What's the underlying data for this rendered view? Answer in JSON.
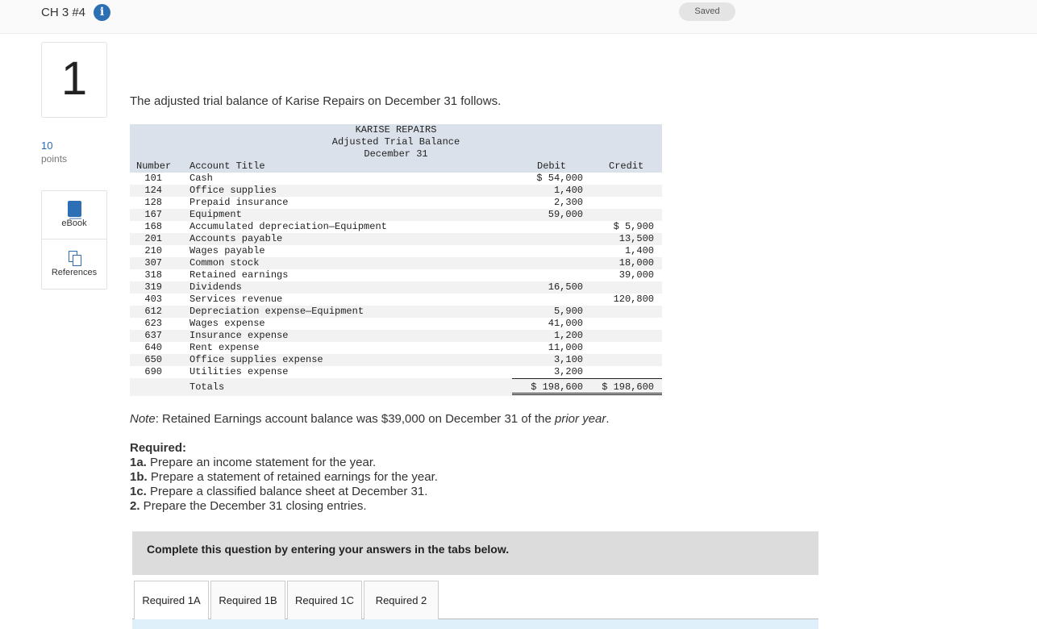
{
  "header": {
    "title": "CH 3 #4",
    "info_glyph": "i",
    "saved_label": "Saved"
  },
  "question": {
    "number": "1",
    "points_value": "10",
    "points_label": "points"
  },
  "tools": {
    "ebook_label": "eBook",
    "references_label": "References"
  },
  "intro_text": "The adjusted trial balance of Karise Repairs on December 31 follows.",
  "trial_balance": {
    "company": "KARISE REPAIRS",
    "statement": "Adjusted Trial Balance",
    "date": "December 31",
    "col_number": "Number",
    "col_title": "Account Title",
    "col_debit": "Debit",
    "col_credit": "Credit",
    "rows": [
      {
        "num": "101",
        "title": "Cash",
        "debit": "$ 54,000",
        "credit": ""
      },
      {
        "num": "124",
        "title": "Office supplies",
        "debit": "1,400",
        "credit": ""
      },
      {
        "num": "128",
        "title": "Prepaid insurance",
        "debit": "2,300",
        "credit": ""
      },
      {
        "num": "167",
        "title": "Equipment",
        "debit": "59,000",
        "credit": ""
      },
      {
        "num": "168",
        "title": "Accumulated depreciation—Equipment",
        "debit": "",
        "credit": "$ 5,900"
      },
      {
        "num": "201",
        "title": "Accounts payable",
        "debit": "",
        "credit": "13,500"
      },
      {
        "num": "210",
        "title": "Wages payable",
        "debit": "",
        "credit": "1,400"
      },
      {
        "num": "307",
        "title": "Common stock",
        "debit": "",
        "credit": "18,000"
      },
      {
        "num": "318",
        "title": "Retained earnings",
        "debit": "",
        "credit": "39,000"
      },
      {
        "num": "319",
        "title": "Dividends",
        "debit": "16,500",
        "credit": ""
      },
      {
        "num": "403",
        "title": "Services revenue",
        "debit": "",
        "credit": "120,800"
      },
      {
        "num": "612",
        "title": "Depreciation expense—Equipment",
        "debit": "5,900",
        "credit": ""
      },
      {
        "num": "623",
        "title": "Wages expense",
        "debit": "41,000",
        "credit": ""
      },
      {
        "num": "637",
        "title": "Insurance expense",
        "debit": "1,200",
        "credit": ""
      },
      {
        "num": "640",
        "title": "Rent expense",
        "debit": "11,000",
        "credit": ""
      },
      {
        "num": "650",
        "title": "Office supplies expense",
        "debit": "3,100",
        "credit": ""
      },
      {
        "num": "690",
        "title": "Utilities expense",
        "debit": "3,200",
        "credit": ""
      }
    ],
    "totals_label": "Totals",
    "totals_debit": "$ 198,600",
    "totals_credit": "$ 198,600"
  },
  "note": {
    "label": "Note",
    "text_a": ": Retained Earnings account balance was $39,000 on December 31 of the ",
    "emph": "prior year",
    "text_b": "."
  },
  "required": {
    "heading": "Required:",
    "items": [
      {
        "tag": "1a.",
        "text": " Prepare an income statement for the year."
      },
      {
        "tag": "1b.",
        "text": " Prepare a statement of retained earnings for the year."
      },
      {
        "tag": "1c.",
        "text": " Prepare a classified balance sheet at December 31."
      },
      {
        "tag": "2.",
        "text": " Prepare the December 31 closing entries."
      }
    ]
  },
  "instructions": "Complete this question by entering your answers in the tabs below.",
  "tabs": [
    {
      "label": "Required 1A",
      "active": true
    },
    {
      "label": "Required 1B",
      "active": false
    },
    {
      "label": "Required 1C",
      "active": false
    },
    {
      "label": "Required 2",
      "active": false
    }
  ],
  "colors": {
    "accent": "#2d6fb5",
    "table_header_bg": "#dbe1ea",
    "panel_bg": "#dff0fb"
  }
}
